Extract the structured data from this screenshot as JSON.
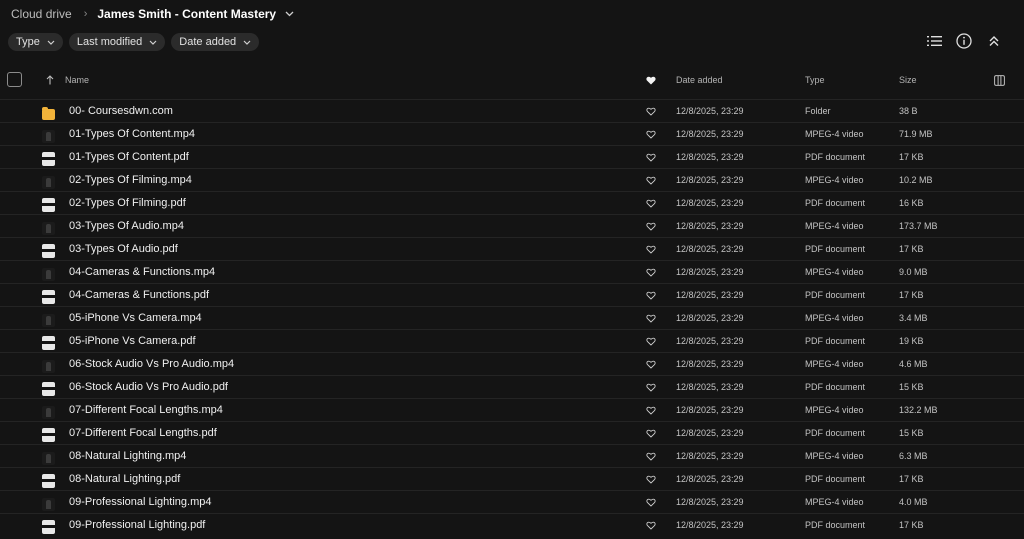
{
  "breadcrumb": {
    "root": "Cloud drive",
    "current": "James Smith - Content Mastery"
  },
  "filters": [
    {
      "label": "Type"
    },
    {
      "label": "Last modified"
    },
    {
      "label": "Date added"
    }
  ],
  "toolbar": {
    "icons": [
      "list-view-icon",
      "info-icon",
      "collapse-icon"
    ]
  },
  "columns": {
    "name": "Name",
    "date_added": "Date added",
    "type": "Type",
    "size": "Size"
  },
  "files": [
    {
      "name": "00- Coursesdwn.com",
      "kind": "folder",
      "date": "12/8/2025, 23:29",
      "type": "Folder",
      "size": "38 B"
    },
    {
      "name": "01-Types Of Content.mp4",
      "kind": "video",
      "date": "12/8/2025, 23:29",
      "type": "MPEG-4 video",
      "size": "71.9 MB"
    },
    {
      "name": "01-Types Of Content.pdf",
      "kind": "pdf",
      "date": "12/8/2025, 23:29",
      "type": "PDF document",
      "size": "17 KB"
    },
    {
      "name": "02-Types Of Filming.mp4",
      "kind": "video",
      "date": "12/8/2025, 23:29",
      "type": "MPEG-4 video",
      "size": "10.2 MB"
    },
    {
      "name": "02-Types Of Filming.pdf",
      "kind": "pdf",
      "date": "12/8/2025, 23:29",
      "type": "PDF document",
      "size": "16 KB"
    },
    {
      "name": "03-Types Of Audio.mp4",
      "kind": "video",
      "date": "12/8/2025, 23:29",
      "type": "MPEG-4 video",
      "size": "173.7 MB"
    },
    {
      "name": "03-Types Of Audio.pdf",
      "kind": "pdf",
      "date": "12/8/2025, 23:29",
      "type": "PDF document",
      "size": "17 KB"
    },
    {
      "name": "04-Cameras & Functions.mp4",
      "kind": "video",
      "date": "12/8/2025, 23:29",
      "type": "MPEG-4 video",
      "size": "9.0 MB"
    },
    {
      "name": "04-Cameras & Functions.pdf",
      "kind": "pdf",
      "date": "12/8/2025, 23:29",
      "type": "PDF document",
      "size": "17 KB"
    },
    {
      "name": "05-iPhone Vs Camera.mp4",
      "kind": "video",
      "date": "12/8/2025, 23:29",
      "type": "MPEG-4 video",
      "size": "3.4 MB"
    },
    {
      "name": "05-iPhone Vs Camera.pdf",
      "kind": "pdf",
      "date": "12/8/2025, 23:29",
      "type": "PDF document",
      "size": "19 KB"
    },
    {
      "name": "06-Stock Audio Vs Pro Audio.mp4",
      "kind": "video",
      "date": "12/8/2025, 23:29",
      "type": "MPEG-4 video",
      "size": "4.6 MB"
    },
    {
      "name": "06-Stock Audio Vs Pro Audio.pdf",
      "kind": "pdf",
      "date": "12/8/2025, 23:29",
      "type": "PDF document",
      "size": "15 KB"
    },
    {
      "name": "07-Different Focal Lengths.mp4",
      "kind": "video",
      "date": "12/8/2025, 23:29",
      "type": "MPEG-4 video",
      "size": "132.2 MB"
    },
    {
      "name": "07-Different Focal Lengths.pdf",
      "kind": "pdf",
      "date": "12/8/2025, 23:29",
      "type": "PDF document",
      "size": "15 KB"
    },
    {
      "name": "08-Natural Lighting.mp4",
      "kind": "video",
      "date": "12/8/2025, 23:29",
      "type": "MPEG-4 video",
      "size": "6.3 MB"
    },
    {
      "name": "08-Natural Lighting.pdf",
      "kind": "pdf",
      "date": "12/8/2025, 23:29",
      "type": "PDF document",
      "size": "17 KB"
    },
    {
      "name": "09-Professional Lighting.mp4",
      "kind": "video",
      "date": "12/8/2025, 23:29",
      "type": "MPEG-4 video",
      "size": "4.0 MB"
    },
    {
      "name": "09-Professional Lighting.pdf",
      "kind": "pdf",
      "date": "12/8/2025, 23:29",
      "type": "PDF document",
      "size": "17 KB"
    }
  ],
  "colors": {
    "background": "#141414",
    "chip": "#2b2b2b",
    "folder": "#f2b33a"
  }
}
